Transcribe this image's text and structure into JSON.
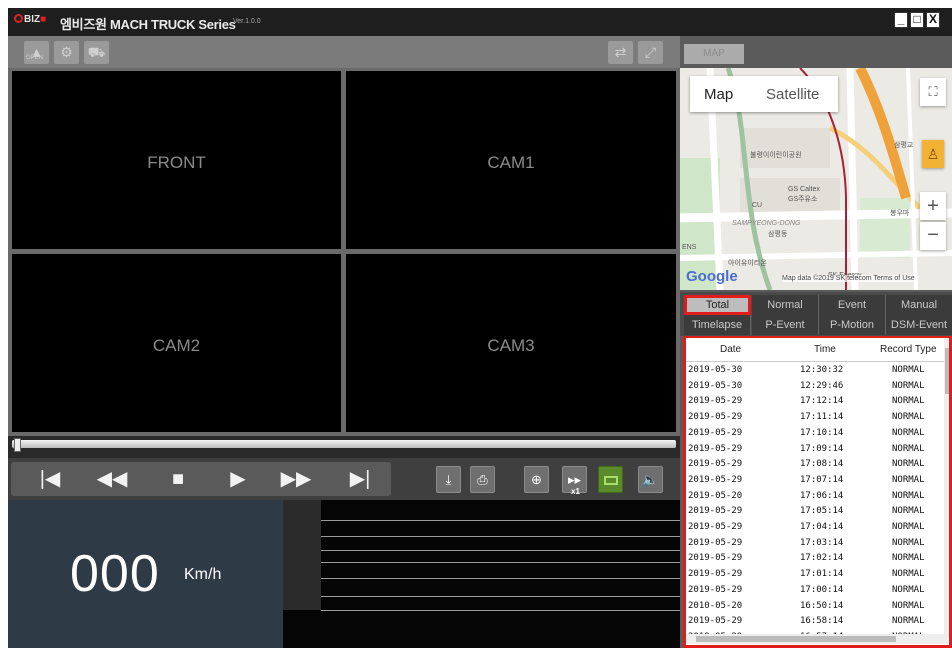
{
  "window": {
    "logo_text": "BIZ",
    "logo_accent": "■",
    "title": "엠비즈원 MACH TRUCK Series",
    "version": "Ver.1.0.0",
    "controls": [
      "_",
      "□",
      "X"
    ]
  },
  "toolbar": {
    "left_icons": [
      "open-icon",
      "settings-icon",
      "truck-icon"
    ],
    "open_small": "OPEN",
    "right_icons": [
      "swap-icon",
      "fullscreen-icon"
    ]
  },
  "cameras": [
    "FRONT",
    "CAM1",
    "CAM2",
    "CAM3"
  ],
  "playback": {
    "buttons": [
      "skip-start",
      "rewind",
      "stop",
      "play",
      "fast-forward",
      "skip-end"
    ],
    "glyphs": [
      "|◀",
      "◀◀",
      "■",
      "▶",
      "▶▶",
      "▶|"
    ],
    "tools": [
      "download-icon",
      "print-icon",
      "zoom-icon",
      "speed-icon",
      "display-icon",
      "volume-icon"
    ],
    "speed_label": "x1"
  },
  "speed": {
    "value": "000",
    "unit": "Km/h"
  },
  "map": {
    "tab_label": "MAP",
    "map_button": "Map",
    "satellite_button": "Satellite",
    "zoom_in": "+",
    "zoom_out": "−",
    "google_logo": "Google",
    "attribution": "Map data ©2019 SK telecom   Terms of Use",
    "labels": [
      "불령이이린이공원",
      "GS Caltex",
      "GS주유소",
      "CU",
      "SAMPYEONG-DONG",
      "삼평동",
      "ENS",
      "아이유이리온",
      "삼평교",
      "봉우마",
      "SK Energy"
    ]
  },
  "filters": {
    "row1": [
      "Total",
      "Normal",
      "Event",
      "Manual"
    ],
    "row2": [
      "Timelapse",
      "P-Event",
      "P-Motion",
      "DSM-Event"
    ],
    "active": "Total"
  },
  "records": {
    "headers": [
      "Date",
      "Time",
      "Record Type"
    ],
    "rows": [
      [
        "2019-05-30",
        "12:30:32",
        "NORMAL"
      ],
      [
        "2019-05-30",
        "12:29:46",
        "NORMAL"
      ],
      [
        "2019-05-29",
        "17:12:14",
        "NORMAL"
      ],
      [
        "2019-05-29",
        "17:11:14",
        "NORMAL"
      ],
      [
        "2019-05-29",
        "17:10:14",
        "NORMAL"
      ],
      [
        "2019-05-29",
        "17:09:14",
        "NORMAL"
      ],
      [
        "2019-05-29",
        "17:08:14",
        "NORMAL"
      ],
      [
        "2019-05-29",
        "17:07:14",
        "NORMAL"
      ],
      [
        "2019-05-20",
        "17:06:14",
        "NORMAL"
      ],
      [
        "2019-05-29",
        "17:05:14",
        "NORMAL"
      ],
      [
        "2019-05-29",
        "17:04:14",
        "NORMAL"
      ],
      [
        "2019-05-29",
        "17:03:14",
        "NORMAL"
      ],
      [
        "2019-05-29",
        "17:02:14",
        "NORMAL"
      ],
      [
        "2019-05-29",
        "17:01:14",
        "NORMAL"
      ],
      [
        "2019-05-29",
        "17:00:14",
        "NORMAL"
      ],
      [
        "2010-05-20",
        "16:50:14",
        "NORMAL"
      ],
      [
        "2019-05-29",
        "16:58:14",
        "NORMAL"
      ],
      [
        "2019-05-29",
        "16:57:14",
        "NORMAL"
      ]
    ]
  },
  "colors": {
    "highlight": "#e21b1b",
    "speed_panel": "#2e3b47",
    "display_button": "#5a8a2a"
  }
}
